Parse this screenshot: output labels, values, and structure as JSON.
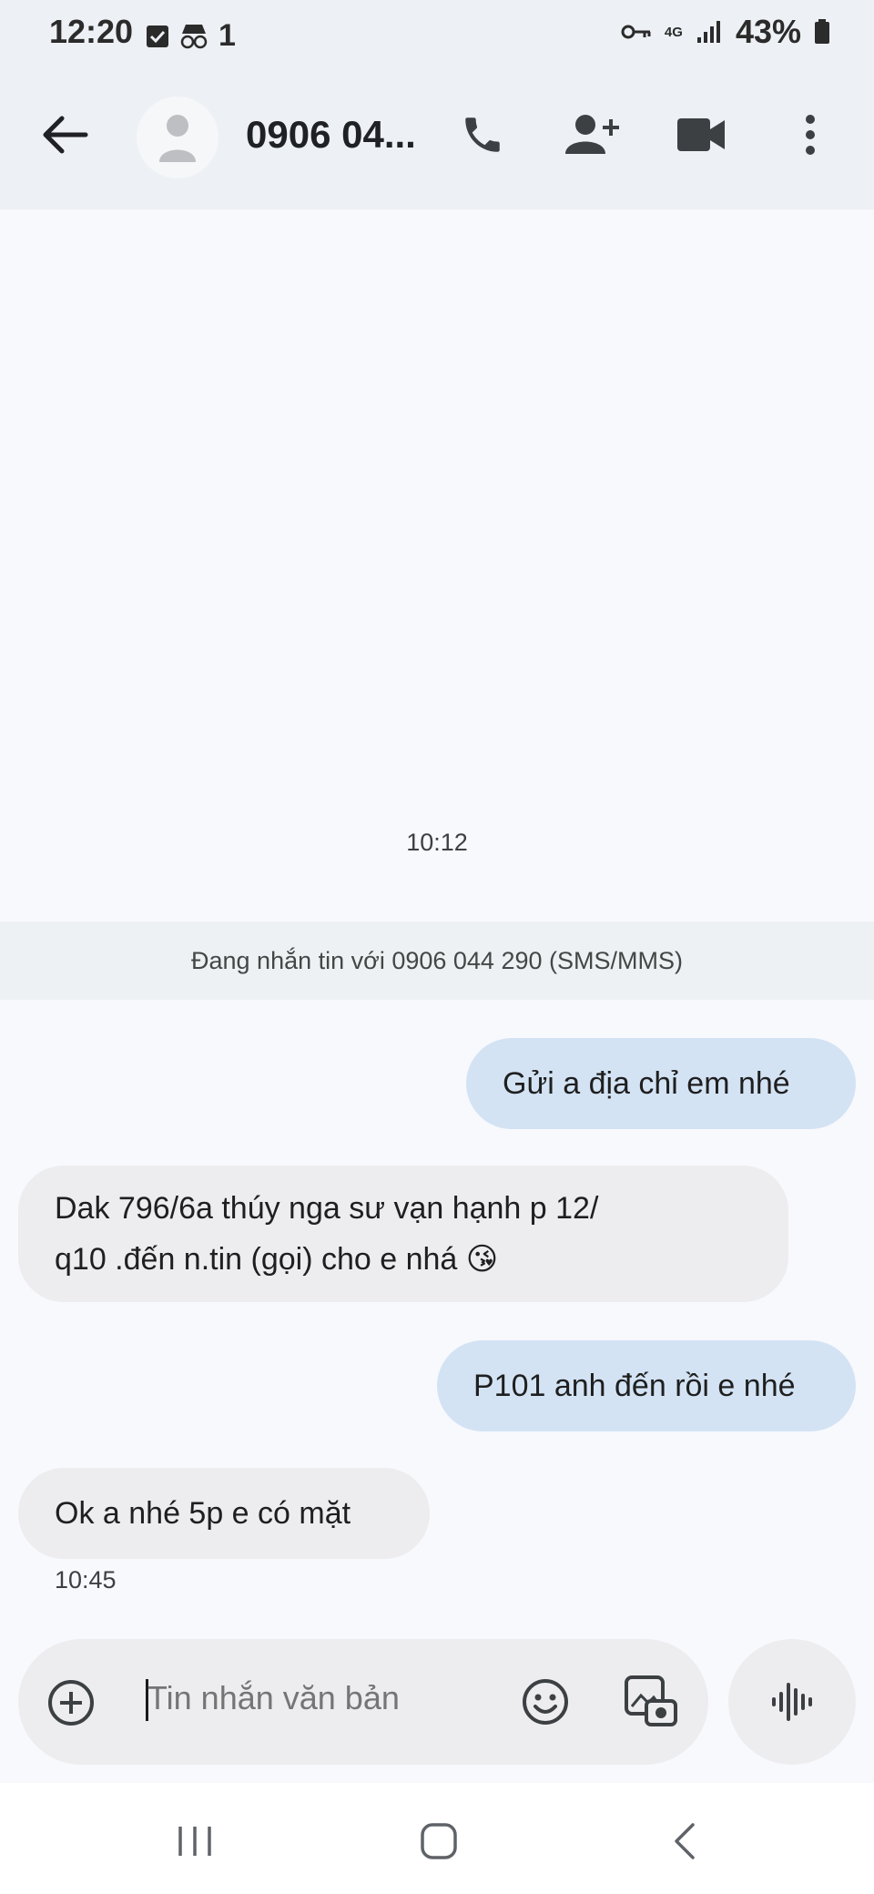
{
  "status_bar": {
    "time": "12:20",
    "notification_count": "1",
    "network": "4G",
    "battery": "43%"
  },
  "header": {
    "contact": "0906 04...",
    "icons": [
      "back-arrow-icon",
      "avatar-icon",
      "phone-icon",
      "add-contact-icon",
      "video-icon",
      "more-vert-icon"
    ]
  },
  "conversation": {
    "timestamp_top": "10:12",
    "banner": "Đang nhắn tin với 0906 044 290 (SMS/MMS)",
    "messages": [
      {
        "direction": "out",
        "text": "Gửi a địa chỉ em nhé"
      },
      {
        "direction": "in",
        "line1": "Dak 796/6a  thúy nga sư vạn hạnh p 12/",
        "line2": "q10 .đến n.tin (gọi) cho e nhá 😘"
      },
      {
        "direction": "out",
        "text": "P101 anh đến rồi e nhé"
      },
      {
        "direction": "in",
        "text": "Ok a  nhé 5p e có mặt"
      }
    ],
    "timestamp_bottom": "10:45"
  },
  "composer": {
    "placeholder": "Tin nhắn văn bản"
  },
  "colors": {
    "outgoing_bubble": "#d3e3f4",
    "incoming_bubble": "#ededf0",
    "header_bg": "#edf0f4"
  }
}
